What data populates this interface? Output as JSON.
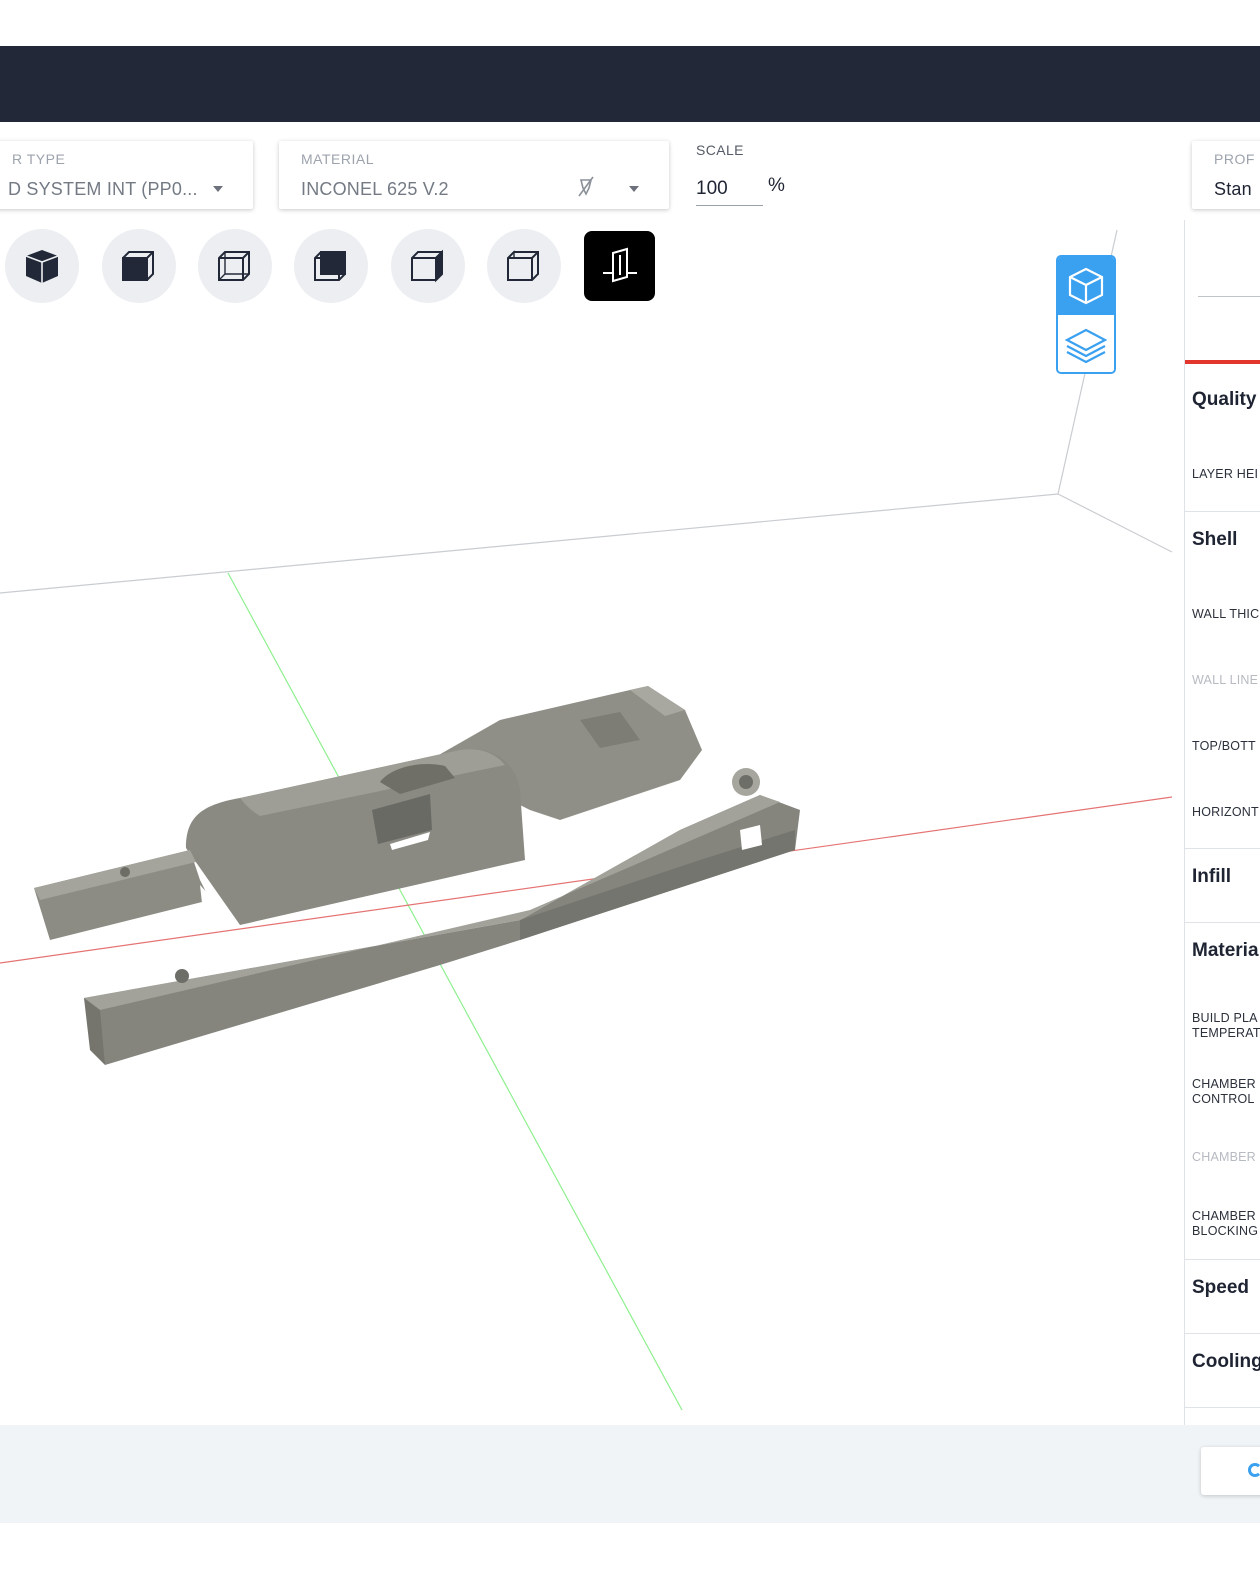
{
  "toolbar": {
    "printer": {
      "label": "R TYPE",
      "value": "D SYSTEM INT (PP0..."
    },
    "material": {
      "label": "MATERIAL",
      "value": "INCONEL 625 V.2",
      "icon": "nozzle-off-icon"
    },
    "scale": {
      "label": "SCALE",
      "value": "100",
      "unit": "%"
    },
    "profile": {
      "label": "PROF",
      "value": "Stan"
    }
  },
  "view_buttons": [
    {
      "name": "solid-view",
      "icon": "cube-solid-icon",
      "active": false
    },
    {
      "name": "front-view",
      "icon": "cube-front-icon",
      "active": false
    },
    {
      "name": "top-view",
      "icon": "cube-top-icon",
      "active": false
    },
    {
      "name": "back-view",
      "icon": "cube-back-icon",
      "active": false
    },
    {
      "name": "side-view",
      "icon": "cube-side-icon",
      "active": false
    },
    {
      "name": "wire-view",
      "icon": "cube-wire-icon",
      "active": false
    },
    {
      "name": "section-view",
      "icon": "section-plane-icon",
      "active": true
    }
  ],
  "mode_toggle": {
    "top": {
      "icon": "cube-3d-icon",
      "active": true
    },
    "bottom": {
      "icon": "layers-icon",
      "active": false
    }
  },
  "colors": {
    "accent": "#3aa0f0",
    "panel_accent": "#e2352b",
    "topbar": "#232838",
    "axis_x": "#e05a5a",
    "axis_y": "#7ee07e",
    "model": "#8e8e86"
  },
  "settings": {
    "quality": {
      "title": "Quality",
      "fields": [
        "LAYER HEI"
      ]
    },
    "shell": {
      "title": "Shell",
      "fields": [
        "WALL THIC",
        "WALL LINE",
        "TOP/BOTT",
        "HORIZONT"
      ]
    },
    "infill": {
      "title": "Infill"
    },
    "material": {
      "title": "Materia",
      "fields": [
        "BUILD PLA\nTEMPERAT",
        "CHAMBER\nCONTROL",
        "CHAMBER",
        "CHAMBER\nBLOCKING"
      ]
    },
    "speed": {
      "title": "Speed"
    },
    "cooling": {
      "title": "Cooling"
    }
  }
}
